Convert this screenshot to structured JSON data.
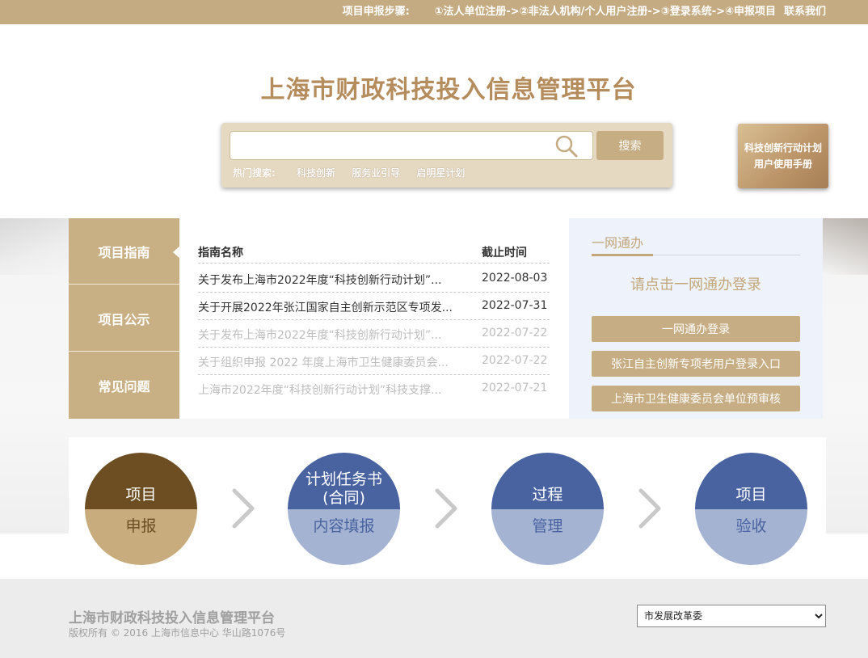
{
  "topbar": {
    "steps_label": "项目申报步骤:",
    "step1": "①法人单位注册->",
    "step2": "②非法人机构/个人用户注册->",
    "step3": "③登录系统->",
    "step4": "④申报项目",
    "contact": "联系我们"
  },
  "header": {
    "title": "上海市财政科技投入信息管理平台"
  },
  "search": {
    "input_value": "",
    "button_label": "搜索",
    "hot_label": "热门搜索:",
    "hot_items": [
      "科技创新",
      "服务业引导",
      "启明星计划"
    ]
  },
  "manual": {
    "line1": "科技创新行动计划",
    "line2": "用户使用手册"
  },
  "side_tabs": [
    "项目指南",
    "项目公示",
    "常见问题"
  ],
  "guides": {
    "header_name": "指南名称",
    "header_date": "截止时间",
    "rows": [
      {
        "name": "关于发布上海市2022年度“科技创新行动计划”...",
        "date": "2022-08-03"
      },
      {
        "name": "关于开展2022年张江国家自主创新示范区专项发...",
        "date": "2022-07-31"
      },
      {
        "name": "关于发布上海市2022年度“科技创新行动计划”...",
        "date": "2022-07-22"
      },
      {
        "name": "关于组织申报 2022 年度上海市卫生健康委员会...",
        "date": "2022-07-22"
      },
      {
        "name": "上海市2022年度“科技创新行动计划”科技支撑...",
        "date": "2022-07-21"
      }
    ]
  },
  "login": {
    "title": "一网通办",
    "prompt": "请点击一网通办登录",
    "buttons": [
      "一网通办登录",
      "张江自主创新专项老用户登录入口",
      "上海市卫生健康委员会单位预审核"
    ]
  },
  "process": {
    "steps": [
      {
        "top": "项目",
        "bottom": "申报"
      },
      {
        "top": "计划任务书\n(合同)",
        "bottom": "内容填报"
      },
      {
        "top": "过程",
        "bottom": "管理"
      },
      {
        "top": "项目",
        "bottom": "验收"
      }
    ]
  },
  "footer": {
    "title": "上海市财政科技投入信息管理平台",
    "copyright": "版权所有 © 2016 上海市信息中心 华山路1076号",
    "select_value": "市发展改革委"
  },
  "colors": {
    "brand_gold": "#c4ab82",
    "title_gold": "#b58c5c",
    "dark_brown": "#6c4e22",
    "blue": "#4963a0",
    "light_blue": "#a5b3d3"
  }
}
